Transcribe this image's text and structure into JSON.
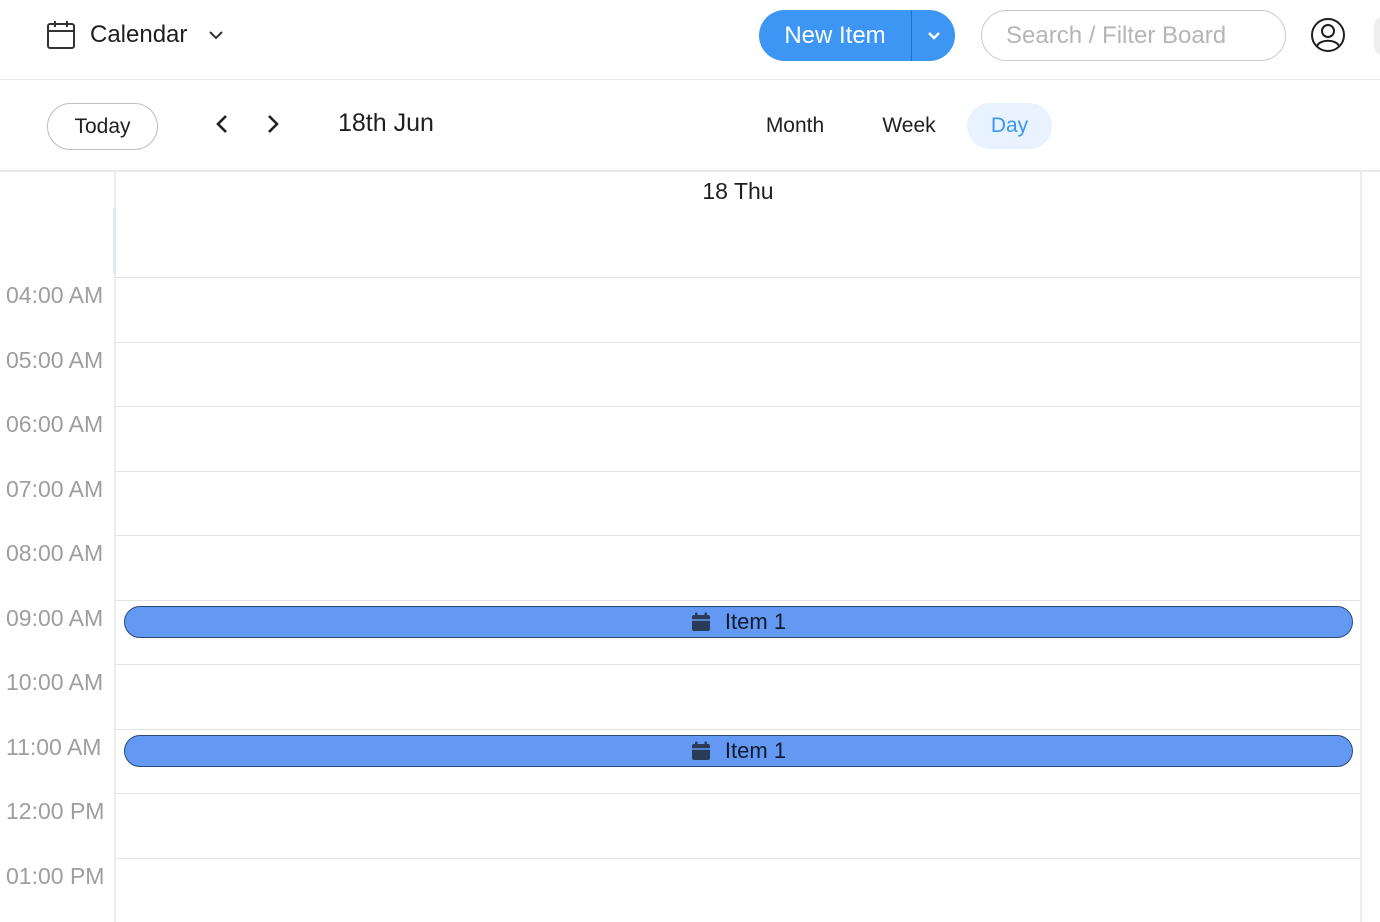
{
  "header": {
    "view_title": "Calendar",
    "new_item_label": "New Item",
    "search_placeholder": "Search / Filter Board",
    "accent_color": "#3d95f4"
  },
  "toolbar": {
    "today_label": "Today",
    "current_date": "18th Jun",
    "modes": [
      {
        "label": "Month",
        "selected": false
      },
      {
        "label": "Week",
        "selected": false
      },
      {
        "label": "Day",
        "selected": true
      }
    ]
  },
  "day_view": {
    "day_label": "18 Thu",
    "hours": [
      "04:00 AM",
      "05:00 AM",
      "06:00 AM",
      "07:00 AM",
      "08:00 AM",
      "09:00 AM",
      "10:00 AM",
      "11:00 AM",
      "12:00 PM",
      "01:00 PM"
    ],
    "events": [
      {
        "label": "Item 1",
        "hour": "09:00 AM",
        "icon": "calendar-icon",
        "color": "#6399f2"
      },
      {
        "label": "Item 1",
        "hour": "11:00 AM",
        "icon": "calendar-icon",
        "color": "#6399f2"
      }
    ]
  }
}
